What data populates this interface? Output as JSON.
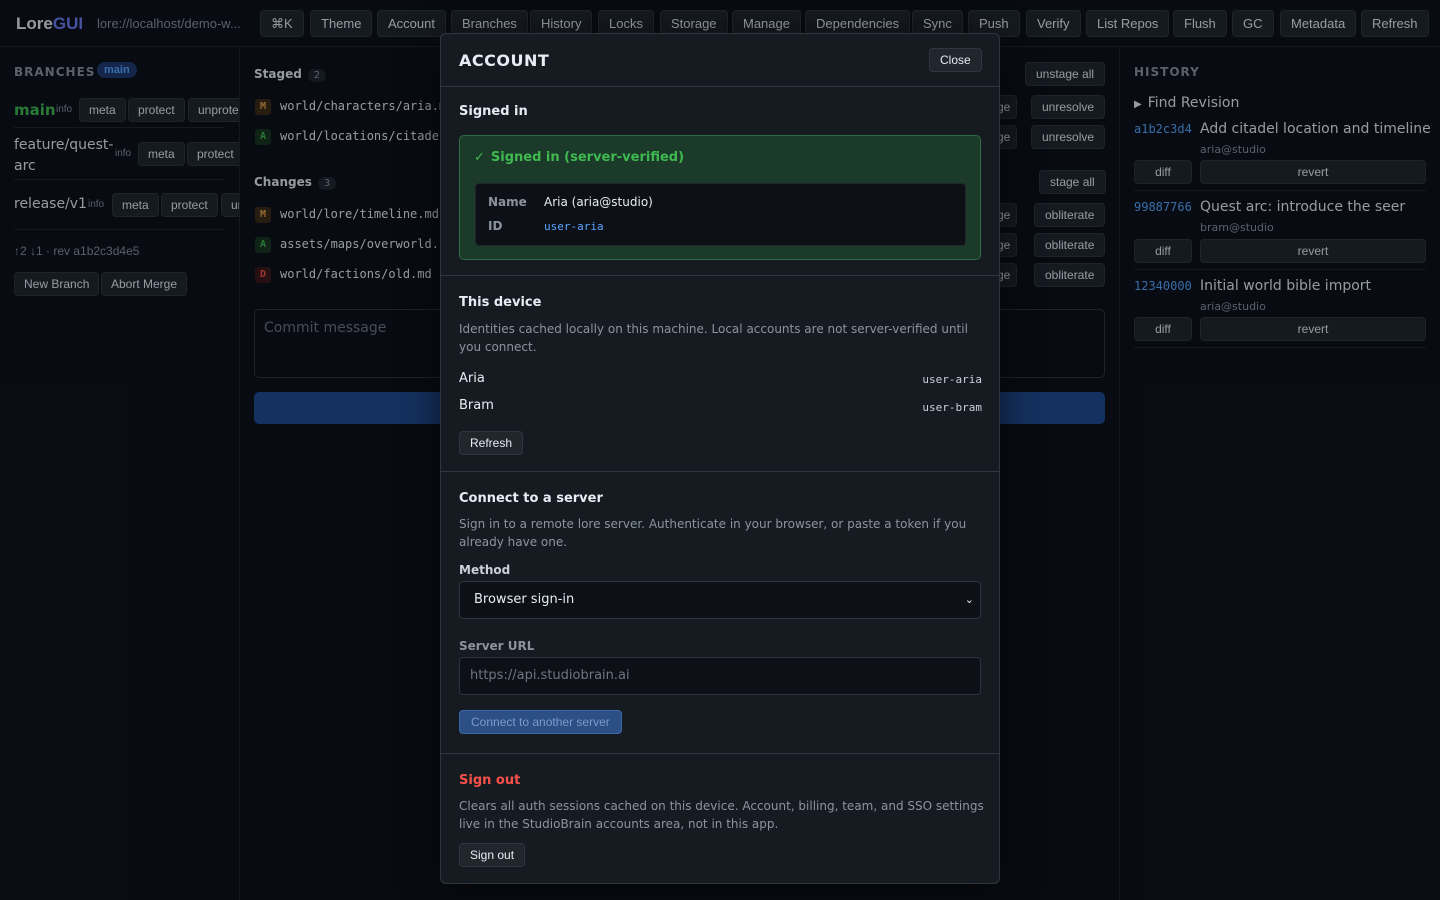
{
  "app": {
    "logo_main": "Lore",
    "logo_accent": "GUI",
    "repo_path": "lore://localhost/demo-w..."
  },
  "toolbar": [
    "⌘K",
    "Theme",
    "Account",
    "Branches",
    "History",
    "Locks",
    "Storage",
    "Manage",
    "Dependencies",
    "Sync",
    "Push",
    "Verify",
    "List Repos",
    "Flush",
    "GC",
    "Metadata",
    "Refresh"
  ],
  "branches": {
    "title": "BRANCHES",
    "current": "main",
    "items": [
      {
        "name": "main",
        "info": "info",
        "actions": [
          "meta",
          "protect",
          "unprote"
        ]
      },
      {
        "name_line1": "feature/quest-",
        "name_line2": "arc",
        "info": "info",
        "actions": [
          "meta",
          "protect"
        ]
      },
      {
        "name": "release/v1",
        "info": "info",
        "actions": [
          "meta",
          "protect",
          "ur"
        ]
      }
    ],
    "status": "↑2 ↓1 · rev a1b2c3d4e5",
    "new_branch": "New Branch",
    "abort_merge": "Abort Merge"
  },
  "staged": {
    "title": "Staged",
    "count": "2",
    "bulk": "unstage all",
    "files": [
      {
        "status": "M",
        "path": "world/characters/aria.m",
        "peek": "ge",
        "action": "unresolve"
      },
      {
        "status": "A",
        "path": "world/locations/citadel",
        "peek": "ge",
        "action": "unresolve"
      }
    ]
  },
  "changes": {
    "title": "Changes",
    "count": "3",
    "bulk": "stage all",
    "files": [
      {
        "status": "M",
        "path": "world/lore/timeline.md",
        "peek": "ge",
        "action": "obliterate"
      },
      {
        "status": "A",
        "path": "assets/maps/overworld.p",
        "peek": "ge",
        "action": "obliterate"
      },
      {
        "status": "D",
        "path": "world/factions/old.md",
        "peek": "ge",
        "action": "obliterate"
      }
    ]
  },
  "commit": {
    "placeholder": "Commit message"
  },
  "history": {
    "title": "HISTORY",
    "find": "Find Revision",
    "commits": [
      {
        "sha": "a1b2c3d4",
        "message": "Add citadel location and timeline",
        "author": "aria@studio",
        "diff": "diff",
        "revert": "revert"
      },
      {
        "sha": "99887766",
        "message": "Quest arc: introduce the seer",
        "author": "bram@studio",
        "diff": "diff",
        "revert": "revert"
      },
      {
        "sha": "12340000",
        "message": "Initial world bible import",
        "author": "aria@studio",
        "diff": "diff",
        "revert": "revert"
      }
    ]
  },
  "modal": {
    "title": "ACCOUNT",
    "close": "Close",
    "signed_in": {
      "heading": "Signed in",
      "status_icon": "✓",
      "status": "Signed in (server-verified)",
      "name_label": "Name",
      "name_value": "Aria (aria@studio)",
      "id_label": "ID",
      "id_value": "user-aria"
    },
    "device": {
      "heading": "This device",
      "description": "Identities cached locally on this machine. Local accounts are not server-verified until you connect.",
      "identities": [
        {
          "name": "Aria",
          "id": "user-aria"
        },
        {
          "name": "Bram",
          "id": "user-bram"
        }
      ],
      "refresh": "Refresh"
    },
    "connect": {
      "heading": "Connect to a server",
      "description": "Sign in to a remote lore server. Authenticate in your browser, or paste a token if you already have one.",
      "method_label": "Method",
      "method_value": "Browser sign-in",
      "url_label": "Server URL",
      "url_placeholder": "https://api.studiobrain.ai",
      "connect_button": "Connect to another server"
    },
    "signout": {
      "heading": "Sign out",
      "description": "Clears all auth sessions cached on this device. Account, billing, team, and SSO settings live in the StudioBrain accounts area, not in this app.",
      "button": "Sign out"
    }
  },
  "colors": {
    "accent": "#58a6ff",
    "success": "#3fb950",
    "danger": "#f85149",
    "background": "#0d1117",
    "panel": "#161b22"
  }
}
